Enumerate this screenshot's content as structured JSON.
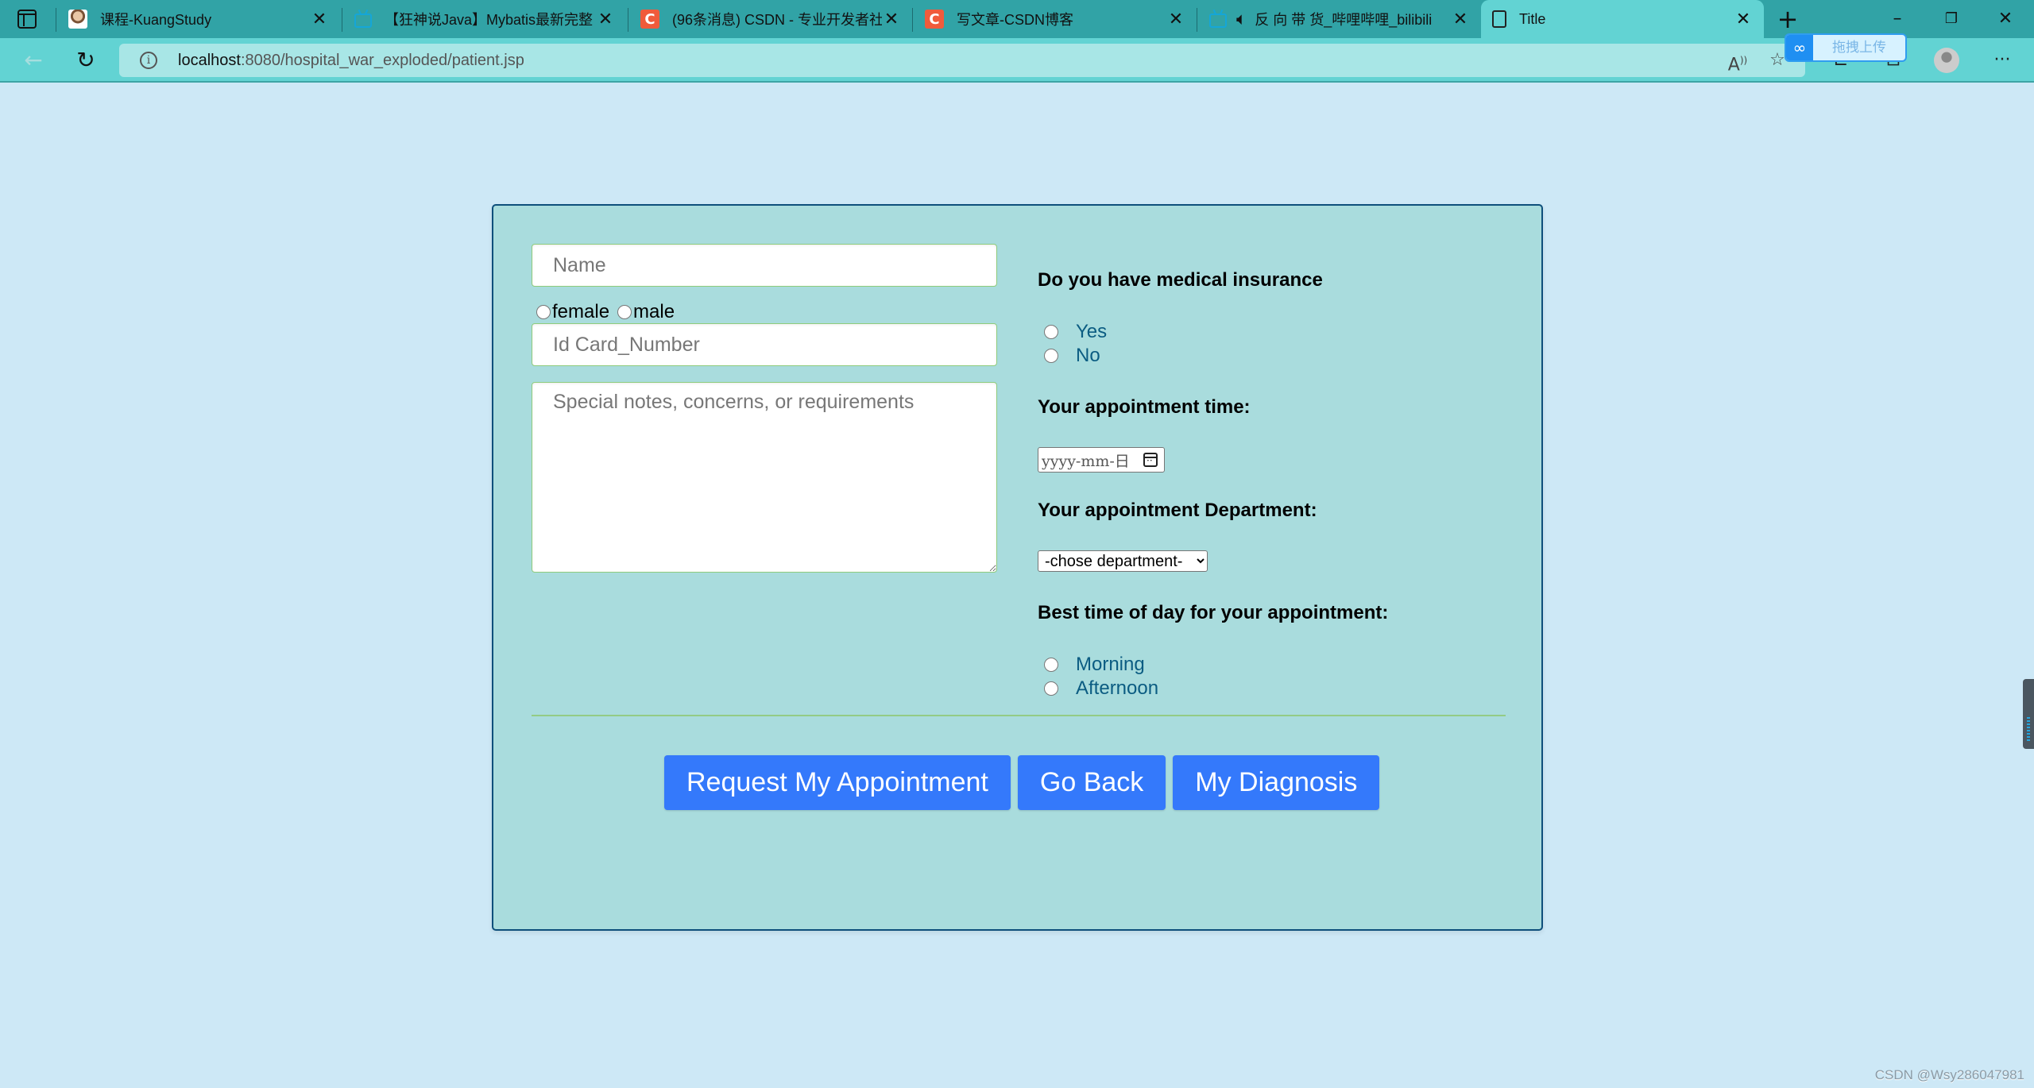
{
  "browser": {
    "tabs": [
      {
        "title": "课程-KuangStudy",
        "favicon": "kuangstudy-avatar-icon",
        "active": false,
        "audio": false
      },
      {
        "title": "【狂神说Java】Mybatis最新完整",
        "favicon": "bilibili-icon",
        "active": false,
        "audio": false
      },
      {
        "title": "(96条消息) CSDN - 专业开发者社",
        "favicon": "csdn-icon",
        "active": false,
        "audio": false
      },
      {
        "title": "写文章-CSDN博客",
        "favicon": "csdn-icon",
        "active": false,
        "audio": false
      },
      {
        "title": "反 向 带 货_哔哩哔哩_bilibili",
        "favicon": "bilibili-icon",
        "active": false,
        "audio": true
      },
      {
        "title": "Title",
        "favicon": "page-icon",
        "active": true,
        "audio": false
      }
    ],
    "tab_close_glyph": "✕",
    "new_tab_glyph": "+",
    "window_controls": {
      "minimize": "–",
      "restore": "❐",
      "close": "✕"
    },
    "address": {
      "host": "localhost",
      "rest": ":8080/hospital_war_exploded/patient.jsp"
    },
    "icons": {
      "back": "←",
      "reload": "↻",
      "info": "i",
      "read_aloud": "Aʔ",
      "favorite": "☆",
      "collections": "⊏",
      "extensions": "⊡",
      "menu": "···"
    },
    "upload_widget": {
      "icon": "∞",
      "label": "拖拽上传"
    }
  },
  "form": {
    "name_placeholder": "Name",
    "gender": {
      "options": [
        "female",
        "male"
      ]
    },
    "id_placeholder": "Id Card_Number",
    "notes_placeholder": "Special notes, concerns, or requirements",
    "insurance": {
      "label": "Do you have medical insurance",
      "options": [
        "Yes",
        "No"
      ]
    },
    "appointment_time": {
      "label": "Your appointment time:",
      "placeholder": "yyyy-mm-日"
    },
    "department": {
      "label": "Your appointment Department:",
      "selected": "-chose department-"
    },
    "best_time": {
      "label": "Best time of day for your appointment:",
      "options": [
        "Morning",
        "Afternoon"
      ]
    },
    "buttons": {
      "request": "Request My Appointment",
      "back": "Go Back",
      "diagnosis": "My Diagnosis"
    }
  },
  "colors": {
    "page_bg": "#cde8f6",
    "card_bg": "#a9dcdd",
    "button_bg": "#3479fb",
    "radio_label": "#0b5c82"
  },
  "watermark": "CSDN @Wsy286047981"
}
